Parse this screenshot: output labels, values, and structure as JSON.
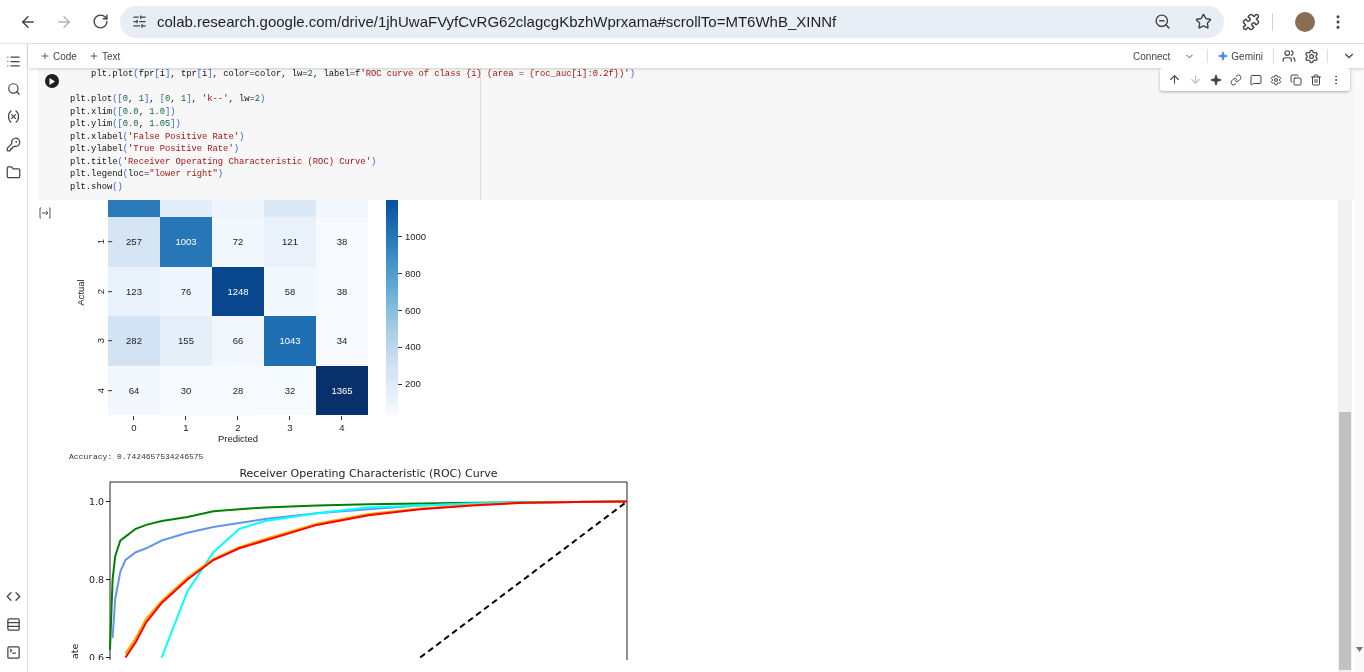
{
  "browser": {
    "url": "colab.research.google.com/drive/1jhUwaFVyfCvRG62clagcgKbzhWprxama#scrollTo=MT6WhB_XINNf",
    "forward_button": {
      "disabled": true
    }
  },
  "toolbar": {
    "add_buttons": [
      "Code",
      "Text"
    ],
    "connect": "Connect",
    "gemini": "Gemini"
  },
  "cell_toolbar": {
    "move_down": {
      "disabled": true
    }
  },
  "code_cell": {
    "blocks": [
      [
        "    plt.plot(fpr[i], tpr[i], color=color, lw=2, label=f'ROC curve of class {i} (area = {roc_auc[i]:0.2f})')"
      ],
      [
        "plt.plot([0, 1], [0, 1], 'k--', lw=2)",
        "plt.xlim([0.0, 1.0])",
        "plt.ylim([0.0, 1.05])",
        "plt.xlabel('False Positive Rate')",
        "plt.ylabel('True Positive Rate')",
        "plt.title('Receiver Operating Characteristic (ROC) Curve')",
        "plt.legend(loc=\"lower right\")",
        "plt.show()"
      ]
    ]
  },
  "output": {
    "heatmap": {
      "ylabel": "Actual",
      "rows": [
        {
          "label": "1",
          "cells": [
            "257",
            "1003",
            "72",
            "121",
            "38"
          ]
        },
        {
          "label": "2",
          "cells": [
            "123",
            "76",
            "1248",
            "58",
            "38"
          ]
        },
        {
          "label": "3",
          "cells": [
            "282",
            "155",
            "66",
            "1043",
            "34"
          ]
        },
        {
          "label": "4",
          "cells": [
            "64",
            "30",
            "28",
            "32",
            "1365"
          ]
        }
      ],
      "x_ticks": [
        "0",
        "1",
        "2",
        "3",
        "4"
      ],
      "xlabel": "Predicted",
      "colorbar_ticks": [
        "1000",
        "800",
        "600",
        "400",
        "200"
      ]
    },
    "accuracy": "Accuracy: 0.7424657534246575",
    "roc_chart": {
      "title": "Receiver Operating Characteristic (ROC) Curve",
      "ylabel": "ate",
      "yticks": [
        "1.0",
        "0.8",
        "0.6"
      ]
    }
  }
}
